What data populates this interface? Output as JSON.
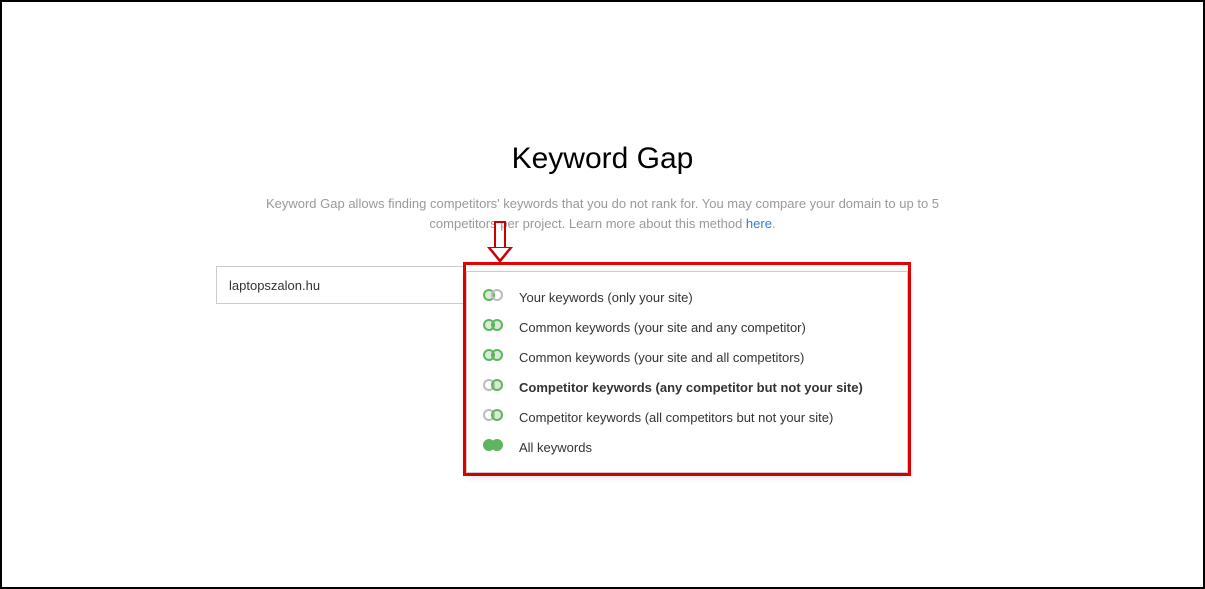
{
  "title": "Keyword Gap",
  "desc1": "Keyword Gap allows finding competitors' keywords that you do not rank for. You may compare your domain to up to 5",
  "desc2": "competitors per project. Learn more about this method ",
  "link": "here",
  "input_value": "laptopszalon.hu",
  "items": [
    {
      "label": "Your keywords (only your site)",
      "bold": false,
      "ic": "g-gr"
    },
    {
      "label": "Common keywords (your site and any competitor)",
      "bold": false,
      "ic": "g-g"
    },
    {
      "label": "Common keywords (your site and all competitors)",
      "bold": false,
      "ic": "g-g"
    },
    {
      "label": "Competitor keywords (any competitor but not your site)",
      "bold": true,
      "ic": "gr-g"
    },
    {
      "label": "Competitor keywords (all competitors but not your site)",
      "bold": false,
      "ic": "gr-g"
    },
    {
      "label": "All keywords",
      "bold": false,
      "ic": "sg-sg"
    }
  ]
}
